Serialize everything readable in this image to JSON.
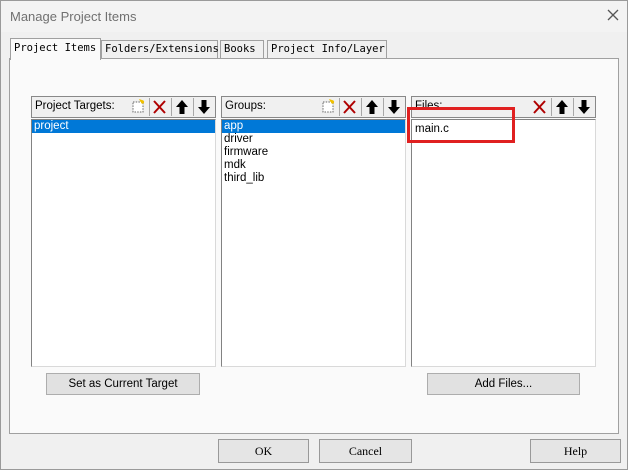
{
  "window": {
    "title": "Manage Project Items"
  },
  "tabs": [
    {
      "label": "Project Items",
      "active": true
    },
    {
      "label": "Folders/Extensions",
      "active": false
    },
    {
      "label": "Books",
      "active": false
    },
    {
      "label": "Project Info/Layer",
      "active": false
    }
  ],
  "targets": {
    "header": "Project Targets:",
    "items": [
      "project"
    ],
    "selected": "project",
    "set_current_label": "Set as Current Target"
  },
  "groups": {
    "header": "Groups:",
    "items": [
      "app",
      "driver",
      "firmware",
      "mdk",
      "third_lib"
    ],
    "selected": "app"
  },
  "files": {
    "header": "Files:",
    "items": [
      "main.c"
    ],
    "add_label": "Add Files..."
  },
  "footer": {
    "ok_label": "OK",
    "cancel_label": "Cancel",
    "help_label": "Help"
  },
  "colors": {
    "selection": "#0078d7",
    "highlight": "#e02020"
  },
  "icons": {
    "new": "new-item-icon",
    "delete": "delete-icon",
    "up": "move-up-icon",
    "down": "move-down-icon",
    "close": "close-icon"
  }
}
